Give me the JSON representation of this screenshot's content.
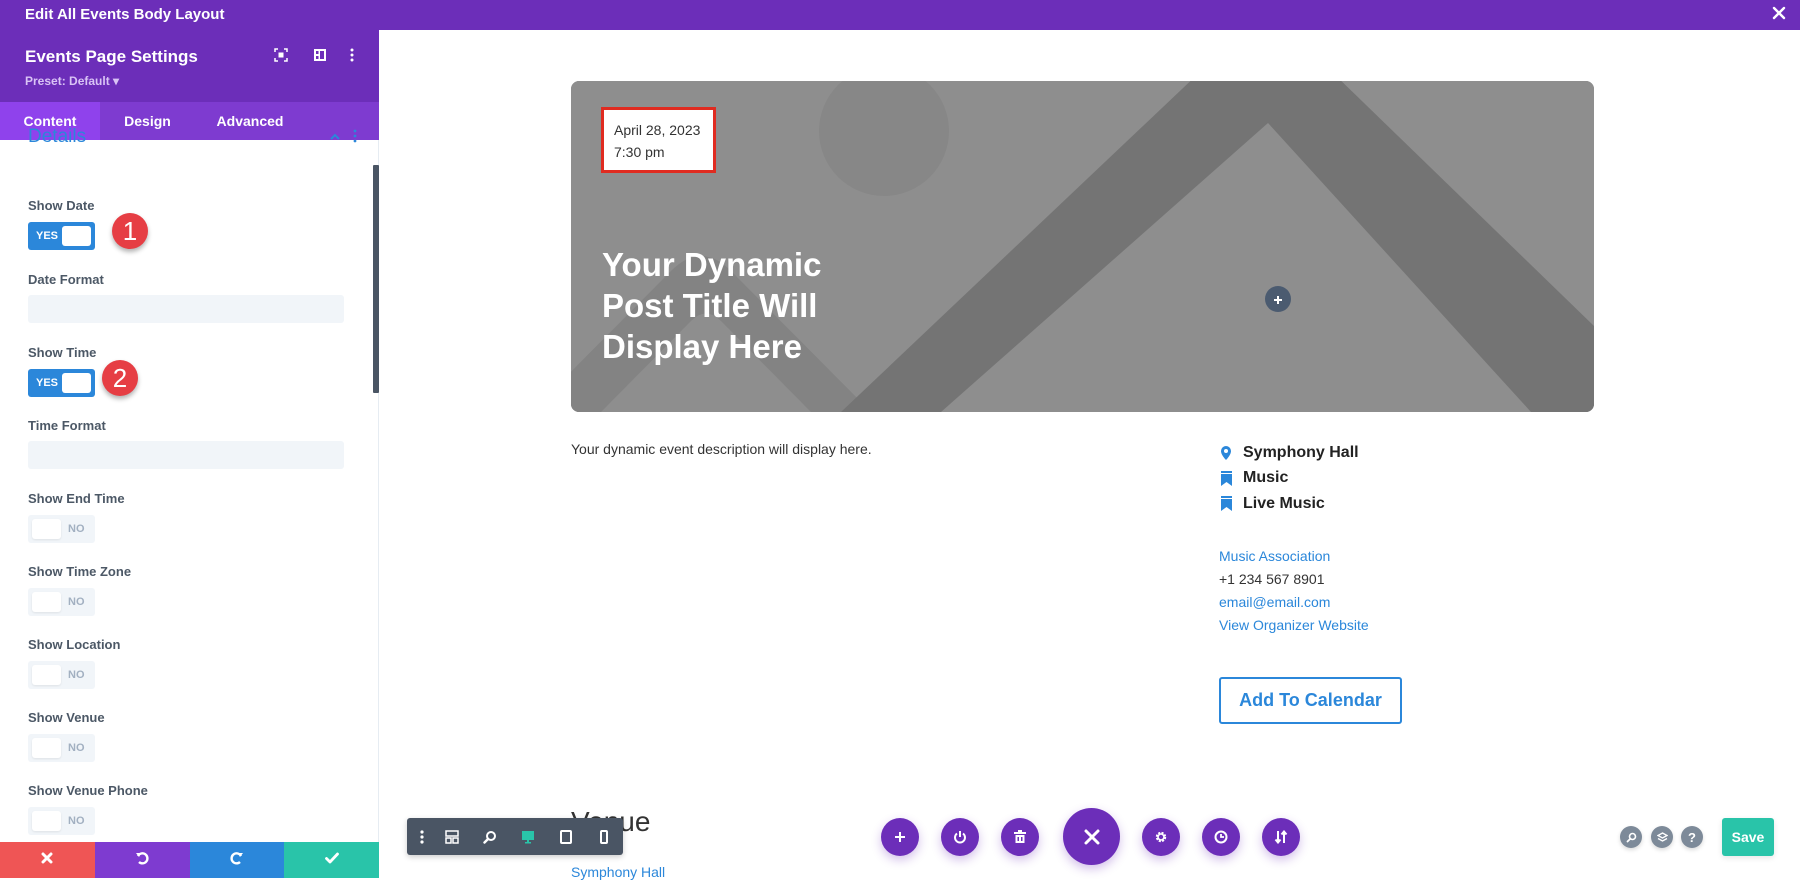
{
  "window": {
    "title": "Edit All Events Body Layout",
    "close_icon": "close-icon"
  },
  "panel": {
    "title": "Events Page Settings",
    "preset": "Preset: Default ▾",
    "header_icons": [
      "focus-icon",
      "split-view-icon",
      "more-vertical-icon"
    ],
    "tabs": [
      {
        "label": "Content",
        "active": true
      },
      {
        "label": "Design",
        "active": false
      },
      {
        "label": "Advanced",
        "active": false
      }
    ],
    "section": {
      "title": "Details",
      "expanded": true
    },
    "fields": {
      "show_date": {
        "label": "Show Date",
        "state": "YES",
        "on": true
      },
      "date_format": {
        "label": "Date Format",
        "value": "",
        "placeholder": ""
      },
      "show_time": {
        "label": "Show Time",
        "state": "YES",
        "on": true
      },
      "time_format": {
        "label": "Time Format",
        "value": "",
        "placeholder": ""
      },
      "show_end_time": {
        "label": "Show End Time",
        "state": "NO",
        "on": false
      },
      "show_time_zone": {
        "label": "Show Time Zone",
        "state": "NO",
        "on": false
      },
      "show_location": {
        "label": "Show Location",
        "state": "NO",
        "on": false
      },
      "show_venue": {
        "label": "Show Venue",
        "state": "NO",
        "on": false
      },
      "show_venue_phone": {
        "label": "Show Venue Phone",
        "state": "NO",
        "on": false
      }
    },
    "annotations": [
      "1",
      "2"
    ],
    "footer": {
      "discard_icon": "close-icon",
      "undo_icon": "undo-icon",
      "redo_icon": "redo-icon",
      "confirm_icon": "check-icon",
      "colors": {
        "discard": "#ef5555",
        "undo": "#7e3bd0",
        "redo": "#2b87da",
        "confirm": "#29c4a9"
      }
    }
  },
  "preview": {
    "hero": {
      "date": "April 28, 2023",
      "time": "7:30 pm",
      "title": "Your Dynamic Post Title Will Display Here"
    },
    "description": "Your dynamic event description will display here.",
    "meta": [
      {
        "icon": "map-pin-icon",
        "label": "Symphony Hall"
      },
      {
        "icon": "bookmark-icon",
        "label": "Music"
      },
      {
        "icon": "bookmark-icon",
        "label": "Live Music"
      }
    ],
    "organizer": {
      "name": "Music Association",
      "phone": "+1 234 567 8901",
      "email": "email@email.com",
      "website_label": "View Organizer Website"
    },
    "calendar_button": "Add To Calendar",
    "venue_heading": "Venue",
    "venue_link": "Symphony Hall"
  },
  "builder": {
    "view_toolbar": [
      "more-vertical-icon",
      "wireframe-icon",
      "zoom-icon",
      "desktop-icon",
      "tablet-icon",
      "phone-icon"
    ],
    "active_view": "desktop",
    "actions": [
      "add-icon",
      "power-icon",
      "trash-icon",
      "close-icon",
      "gear-icon",
      "history-icon",
      "sort-icon"
    ],
    "right_icons": [
      "search-icon",
      "layers-icon",
      "help-icon"
    ],
    "save_label": "Save"
  },
  "colors": {
    "brand_purple": "#6c2eb9",
    "accent_blue": "#2b87da",
    "save_green": "#29c4a9",
    "annotation_red": "#e63e44",
    "date_border": "#e02b20"
  }
}
